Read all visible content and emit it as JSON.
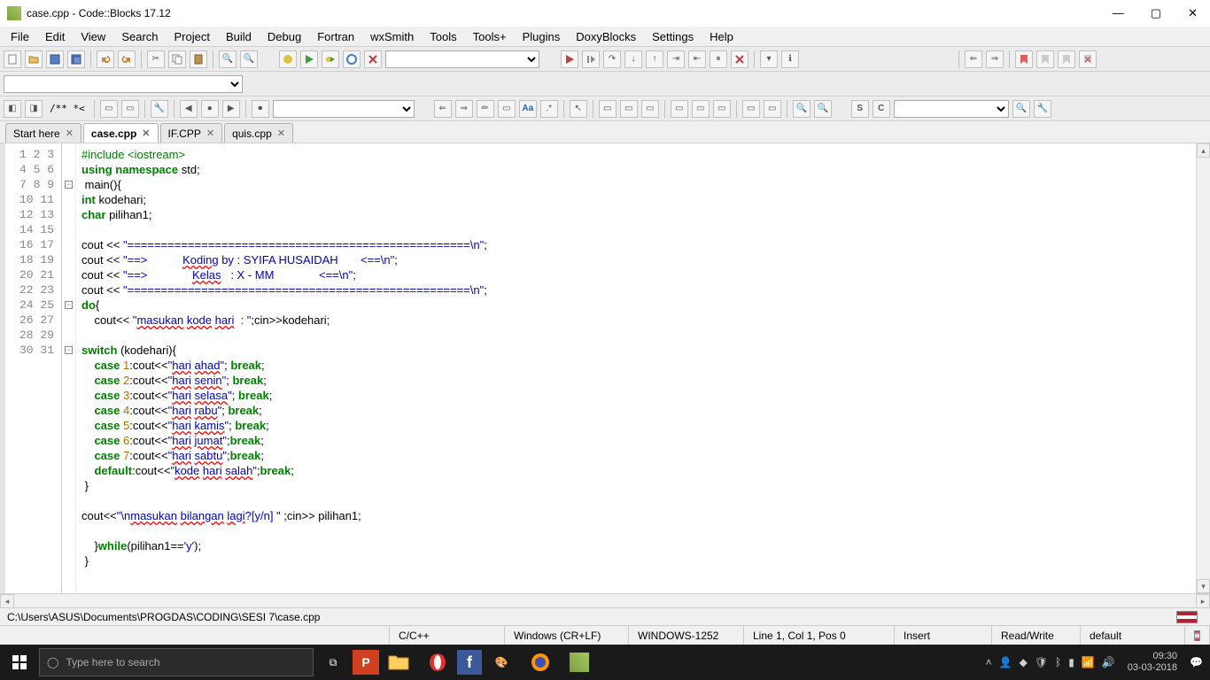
{
  "window": {
    "title": "case.cpp - Code::Blocks 17.12",
    "min": "—",
    "max": "▢",
    "close": "✕"
  },
  "menu": [
    "File",
    "Edit",
    "View",
    "Search",
    "Project",
    "Build",
    "Debug",
    "Fortran",
    "wxSmith",
    "Tools",
    "Tools+",
    "Plugins",
    "DoxyBlocks",
    "Settings",
    "Help"
  ],
  "tabs": [
    {
      "label": "Start here",
      "active": false
    },
    {
      "label": "case.cpp",
      "active": true
    },
    {
      "label": "IF.CPP",
      "active": false
    },
    {
      "label": "quis.cpp",
      "active": false
    }
  ],
  "code_lines": 31,
  "filepath": "C:\\Users\\ASUS\\Documents\\PROGDAS\\CODING\\SESI 7\\case.cpp",
  "status": {
    "lang": "C/C++",
    "eol": "Windows (CR+LF)",
    "enc": "WINDOWS-1252",
    "pos": "Line 1, Col 1, Pos 0",
    "ins": "Insert",
    "rw": "Read/Write",
    "profile": "default"
  },
  "comment_token": "/** *<",
  "s_label": "S",
  "c_label": "C",
  "taskbar": {
    "search_placeholder": "Type here to search",
    "time": "09:30",
    "date": "03-03-2018"
  }
}
